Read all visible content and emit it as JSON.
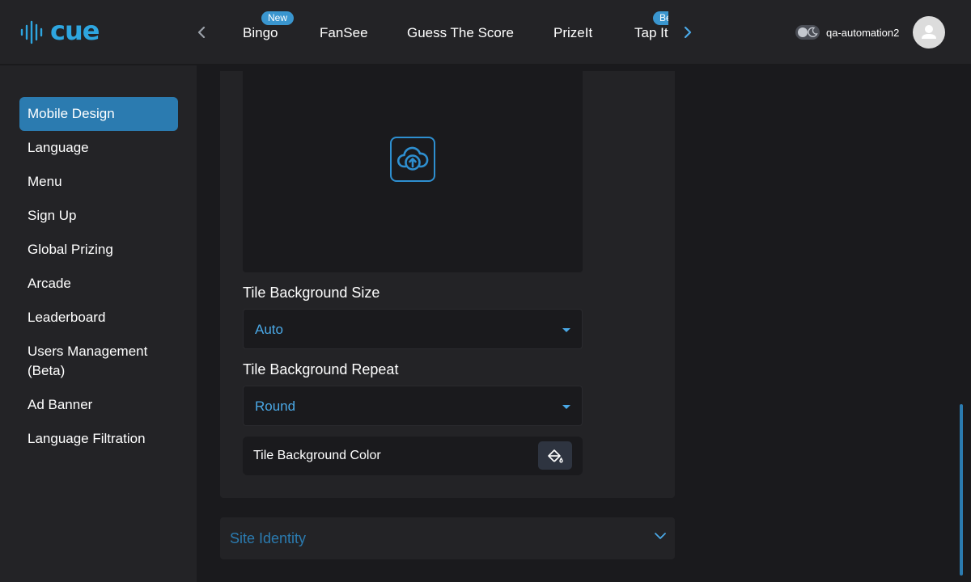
{
  "brand": {
    "logo_text": "cue",
    "accent": "#2ea6e0"
  },
  "header": {
    "game_tabs": [
      {
        "label": "Bingo",
        "badge": "New"
      },
      {
        "label": "FanSee"
      },
      {
        "label": "Guess The Score"
      },
      {
        "label": "PrizeIt"
      },
      {
        "label": "Tap It",
        "badge": "Beta"
      }
    ],
    "prev_icon": "chevron-left-icon",
    "next_icon": "chevron-right-icon",
    "theme_toggle_icon": "moon-icon",
    "username": "qa-automation2",
    "avatar_icon": "user-icon"
  },
  "sidebar": {
    "items": [
      {
        "label": "Mobile Design",
        "active": true
      },
      {
        "label": "Language"
      },
      {
        "label": "Menu"
      },
      {
        "label": "Sign Up"
      },
      {
        "label": "Global Prizing"
      },
      {
        "label": "Arcade"
      },
      {
        "label": "Leaderboard"
      },
      {
        "label": "Users Management (Beta)"
      },
      {
        "label": "Ad Banner"
      },
      {
        "label": "Language Filtration"
      }
    ]
  },
  "main": {
    "upload_icon": "cloud-upload-icon",
    "tile_bg_size": {
      "label": "Tile Background Size",
      "value": "Auto"
    },
    "tile_bg_repeat": {
      "label": "Tile Background Repeat",
      "value": "Round"
    },
    "tile_bg_color": {
      "label": "Tile Background Color",
      "icon": "paint-bucket-icon"
    },
    "site_identity": {
      "title": "Site Identity",
      "icon": "chevron-down-icon"
    }
  },
  "colors": {
    "primary": "#2b7bb0",
    "link": "#4aa8e6",
    "bg": "#1a1a1d",
    "panel": "#232326"
  }
}
